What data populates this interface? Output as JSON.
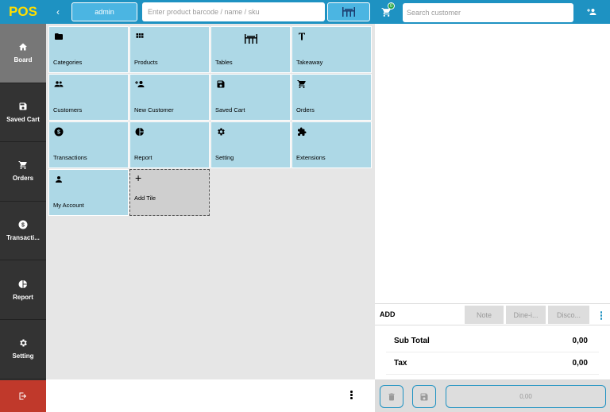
{
  "app": {
    "logo": "POS"
  },
  "sidebar": {
    "items": [
      {
        "label": "Board",
        "icon": "home-icon",
        "active": true
      },
      {
        "label": "Saved Cart",
        "icon": "save-icon"
      },
      {
        "label": "Orders",
        "icon": "cart-icon"
      },
      {
        "label": "Transacti...",
        "icon": "dollar-circle-icon"
      },
      {
        "label": "Report",
        "icon": "pie-chart-icon"
      },
      {
        "label": "Setting",
        "icon": "gear-icon"
      }
    ],
    "logout_icon": "logout-icon"
  },
  "topbar": {
    "user": "admin",
    "search_placeholder": "Enter product barcode / name / sku"
  },
  "tiles": [
    {
      "label": "Categories",
      "icon": "folder-icon"
    },
    {
      "label": "Products",
      "icon": "grid-icon"
    },
    {
      "label": "Tables",
      "icon": "table-icon"
    },
    {
      "label": "Takeaway",
      "icon": "text-t-icon"
    },
    {
      "label": "Customers",
      "icon": "people-icon"
    },
    {
      "label": "New Customer",
      "icon": "person-add-icon"
    },
    {
      "label": "Saved Cart",
      "icon": "save-icon"
    },
    {
      "label": "Orders",
      "icon": "cart-icon"
    },
    {
      "label": "Transactions",
      "icon": "dollar-circle-icon"
    },
    {
      "label": "Report",
      "icon": "pie-chart-icon"
    },
    {
      "label": "Setting",
      "icon": "gear-icon"
    },
    {
      "label": "Extensions",
      "icon": "puzzle-icon"
    },
    {
      "label": "My Account",
      "icon": "person-icon"
    },
    {
      "label": "Add Tile",
      "icon": "plus-icon"
    }
  ],
  "right": {
    "cart_count": "0",
    "search_placeholder": "Search customer",
    "add_label": "ADD",
    "buttons": [
      "Note",
      "Dine-i...",
      "Disco..."
    ],
    "totals": [
      {
        "label": "Sub Total",
        "value": "0,00"
      },
      {
        "label": "Tax",
        "value": "0,00"
      }
    ],
    "pay_amount": "0,00"
  },
  "colors": {
    "primary": "#1e92c2",
    "tile": "#add8e6",
    "logout": "#c0392b",
    "logo_text": "#ffde00"
  }
}
